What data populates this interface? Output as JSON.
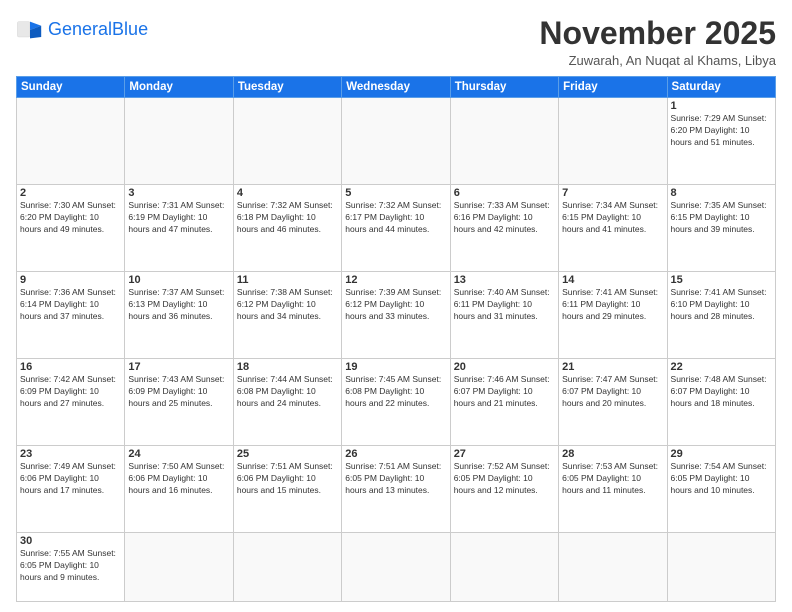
{
  "header": {
    "logo_general": "General",
    "logo_blue": "Blue",
    "month_title": "November 2025",
    "location": "Zuwarah, An Nuqat al Khams, Libya"
  },
  "days_of_week": [
    "Sunday",
    "Monday",
    "Tuesday",
    "Wednesday",
    "Thursday",
    "Friday",
    "Saturday"
  ],
  "weeks": [
    [
      {
        "num": "",
        "info": ""
      },
      {
        "num": "",
        "info": ""
      },
      {
        "num": "",
        "info": ""
      },
      {
        "num": "",
        "info": ""
      },
      {
        "num": "",
        "info": ""
      },
      {
        "num": "",
        "info": ""
      },
      {
        "num": "1",
        "info": "Sunrise: 7:29 AM\nSunset: 6:20 PM\nDaylight: 10 hours and 51 minutes."
      }
    ],
    [
      {
        "num": "2",
        "info": "Sunrise: 7:30 AM\nSunset: 6:20 PM\nDaylight: 10 hours and 49 minutes."
      },
      {
        "num": "3",
        "info": "Sunrise: 7:31 AM\nSunset: 6:19 PM\nDaylight: 10 hours and 47 minutes."
      },
      {
        "num": "4",
        "info": "Sunrise: 7:32 AM\nSunset: 6:18 PM\nDaylight: 10 hours and 46 minutes."
      },
      {
        "num": "5",
        "info": "Sunrise: 7:32 AM\nSunset: 6:17 PM\nDaylight: 10 hours and 44 minutes."
      },
      {
        "num": "6",
        "info": "Sunrise: 7:33 AM\nSunset: 6:16 PM\nDaylight: 10 hours and 42 minutes."
      },
      {
        "num": "7",
        "info": "Sunrise: 7:34 AM\nSunset: 6:15 PM\nDaylight: 10 hours and 41 minutes."
      },
      {
        "num": "8",
        "info": "Sunrise: 7:35 AM\nSunset: 6:15 PM\nDaylight: 10 hours and 39 minutes."
      }
    ],
    [
      {
        "num": "9",
        "info": "Sunrise: 7:36 AM\nSunset: 6:14 PM\nDaylight: 10 hours and 37 minutes."
      },
      {
        "num": "10",
        "info": "Sunrise: 7:37 AM\nSunset: 6:13 PM\nDaylight: 10 hours and 36 minutes."
      },
      {
        "num": "11",
        "info": "Sunrise: 7:38 AM\nSunset: 6:12 PM\nDaylight: 10 hours and 34 minutes."
      },
      {
        "num": "12",
        "info": "Sunrise: 7:39 AM\nSunset: 6:12 PM\nDaylight: 10 hours and 33 minutes."
      },
      {
        "num": "13",
        "info": "Sunrise: 7:40 AM\nSunset: 6:11 PM\nDaylight: 10 hours and 31 minutes."
      },
      {
        "num": "14",
        "info": "Sunrise: 7:41 AM\nSunset: 6:11 PM\nDaylight: 10 hours and 29 minutes."
      },
      {
        "num": "15",
        "info": "Sunrise: 7:41 AM\nSunset: 6:10 PM\nDaylight: 10 hours and 28 minutes."
      }
    ],
    [
      {
        "num": "16",
        "info": "Sunrise: 7:42 AM\nSunset: 6:09 PM\nDaylight: 10 hours and 27 minutes."
      },
      {
        "num": "17",
        "info": "Sunrise: 7:43 AM\nSunset: 6:09 PM\nDaylight: 10 hours and 25 minutes."
      },
      {
        "num": "18",
        "info": "Sunrise: 7:44 AM\nSunset: 6:08 PM\nDaylight: 10 hours and 24 minutes."
      },
      {
        "num": "19",
        "info": "Sunrise: 7:45 AM\nSunset: 6:08 PM\nDaylight: 10 hours and 22 minutes."
      },
      {
        "num": "20",
        "info": "Sunrise: 7:46 AM\nSunset: 6:07 PM\nDaylight: 10 hours and 21 minutes."
      },
      {
        "num": "21",
        "info": "Sunrise: 7:47 AM\nSunset: 6:07 PM\nDaylight: 10 hours and 20 minutes."
      },
      {
        "num": "22",
        "info": "Sunrise: 7:48 AM\nSunset: 6:07 PM\nDaylight: 10 hours and 18 minutes."
      }
    ],
    [
      {
        "num": "23",
        "info": "Sunrise: 7:49 AM\nSunset: 6:06 PM\nDaylight: 10 hours and 17 minutes."
      },
      {
        "num": "24",
        "info": "Sunrise: 7:50 AM\nSunset: 6:06 PM\nDaylight: 10 hours and 16 minutes."
      },
      {
        "num": "25",
        "info": "Sunrise: 7:51 AM\nSunset: 6:06 PM\nDaylight: 10 hours and 15 minutes."
      },
      {
        "num": "26",
        "info": "Sunrise: 7:51 AM\nSunset: 6:05 PM\nDaylight: 10 hours and 13 minutes."
      },
      {
        "num": "27",
        "info": "Sunrise: 7:52 AM\nSunset: 6:05 PM\nDaylight: 10 hours and 12 minutes."
      },
      {
        "num": "28",
        "info": "Sunrise: 7:53 AM\nSunset: 6:05 PM\nDaylight: 10 hours and 11 minutes."
      },
      {
        "num": "29",
        "info": "Sunrise: 7:54 AM\nSunset: 6:05 PM\nDaylight: 10 hours and 10 minutes."
      }
    ],
    [
      {
        "num": "30",
        "info": "Sunrise: 7:55 AM\nSunset: 6:05 PM\nDaylight: 10 hours and 9 minutes."
      },
      {
        "num": "",
        "info": ""
      },
      {
        "num": "",
        "info": ""
      },
      {
        "num": "",
        "info": ""
      },
      {
        "num": "",
        "info": ""
      },
      {
        "num": "",
        "info": ""
      },
      {
        "num": "",
        "info": ""
      }
    ]
  ]
}
